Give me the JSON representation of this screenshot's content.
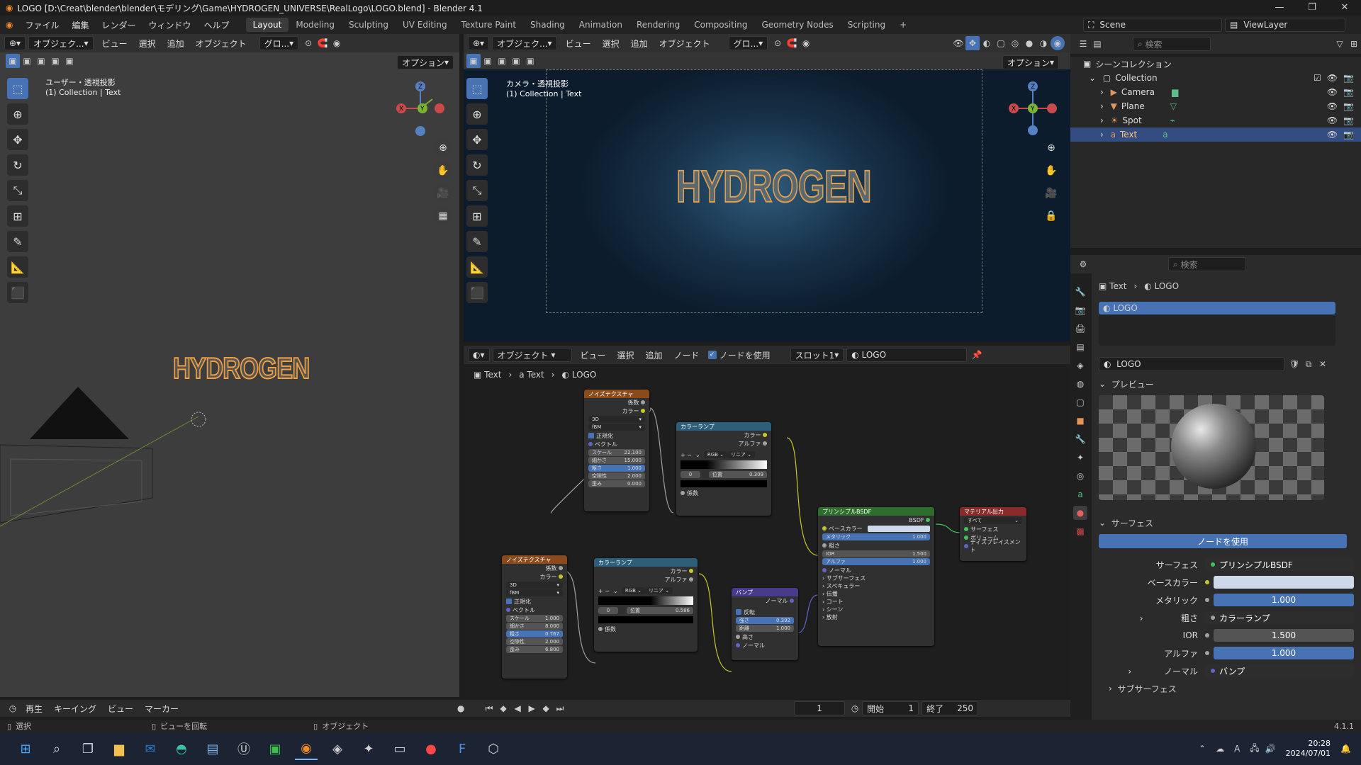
{
  "window": {
    "title": "LOGO [D:\\Creat\\blender\\blender\\モデリング\\Game\\HYDROGEN_UNIVERSE\\RealLogo\\LOGO.blend] - Blender 4.1"
  },
  "menu": [
    "ファイル",
    "編集",
    "レンダー",
    "ウィンドウ",
    "ヘルプ"
  ],
  "workspaces": [
    "Layout",
    "Modeling",
    "Sculpting",
    "UV Editing",
    "Texture Paint",
    "Shading",
    "Animation",
    "Rendering",
    "Compositing",
    "Geometry Nodes",
    "Scripting"
  ],
  "scene": {
    "scene_label": "Scene",
    "viewlayer_label": "ViewLayer"
  },
  "viewport_left": {
    "mode": "オブジェク...",
    "menus": [
      "ビュー",
      "選択",
      "追加",
      "オブジェクト"
    ],
    "orient": "グロ...",
    "options": "オプション",
    "info1": "ユーザー・透視投影",
    "info2": "(1) Collection | Text",
    "logo_text": "HYDROGEN"
  },
  "viewport_right": {
    "mode": "オブジェク...",
    "menus": [
      "ビュー",
      "選択",
      "追加",
      "オブジェクト"
    ],
    "orient": "グロ...",
    "options": "オプション",
    "info1": "カメラ・透視投影",
    "info2": "(1) Collection | Text",
    "logo_text": "HYDROGEN"
  },
  "node_editor": {
    "mode": "オブジェクト",
    "menus": [
      "ビュー",
      "選択",
      "追加",
      "ノード"
    ],
    "use_nodes": "ノードを使用",
    "slot": "スロット1",
    "material": "LOGO",
    "breadcrumb": [
      "Text",
      "Text",
      "LOGO"
    ]
  },
  "nodes": {
    "noise1": {
      "title": "ノイズテクスチャ",
      "out1": "係数",
      "out2": "カラー",
      "dim": "3D",
      "type": "fBM",
      "normalize": "正規化",
      "vector": "ベクトル",
      "rows": [
        [
          "スケール",
          "22.100"
        ],
        [
          "細かさ",
          "15.000"
        ],
        [
          "粗さ",
          "1.000"
        ],
        [
          "空隙性",
          "2.000"
        ],
        [
          "歪み",
          "0.000"
        ]
      ]
    },
    "ramp1": {
      "title": "カラーランプ",
      "out1": "カラー",
      "out2": "アルファ",
      "mode": "RGB",
      "interp": "リニア",
      "idx": "0",
      "pos_label": "位置",
      "pos": "0.309",
      "in": "係数"
    },
    "noise2": {
      "title": "ノイズテクスチャ",
      "out1": "係数",
      "out2": "カラー",
      "dim": "3D",
      "type": "fBM",
      "normalize": "正規化",
      "vector": "ベクトル",
      "rows": [
        [
          "スケール",
          "1.000"
        ],
        [
          "細かさ",
          "8.000"
        ],
        [
          "粗さ",
          "0.767"
        ],
        [
          "空隙性",
          "2.000"
        ],
        [
          "歪み",
          "6.800"
        ]
      ]
    },
    "ramp2": {
      "title": "カラーランプ",
      "out1": "カラー",
      "out2": "アルファ",
      "mode": "RGB",
      "interp": "リニア",
      "idx": "0",
      "pos_label": "位置",
      "pos": "0.586",
      "in": "係数"
    },
    "bump": {
      "title": "バンプ",
      "out": "ノーマル",
      "invert": "反転",
      "rows": [
        [
          "強さ",
          "0.392"
        ],
        [
          "距離",
          "1.000"
        ]
      ],
      "in1": "高さ",
      "in2": "ノーマル"
    },
    "bsdf": {
      "title": "プリンシプルBSDF",
      "out": "BSDF",
      "base": "ベースカラー",
      "metal": "メタリック",
      "metal_v": "1.000",
      "rough": "粗さ",
      "ior": "IOR",
      "ior_v": "1.500",
      "alpha": "アルファ",
      "alpha_v": "1.000",
      "normal": "ノーマル",
      "subs": [
        "サブサーフェス",
        "スペキュラー",
        "伝播",
        "コート",
        "シーン",
        "放射"
      ]
    },
    "output": {
      "title": "マテリアル出力",
      "target": "すべて",
      "ins": [
        "サーフェス",
        "ボリューム",
        "ディスプレイスメント"
      ]
    }
  },
  "outliner": {
    "root": "シーンコレクション",
    "collection": "Collection",
    "items": [
      "Camera",
      "Plane",
      "Spot",
      "Text"
    ]
  },
  "properties": {
    "search": "検索",
    "breadcrumb": [
      "Text",
      "LOGO"
    ],
    "slot": "LOGO",
    "material": "LOGO",
    "preview": "プレビュー",
    "surface": "サーフェス",
    "use_nodes": "ノードを使用",
    "rows": [
      [
        "サーフェス",
        "プリンシプルBSDF"
      ],
      [
        "ベースカラー",
        ""
      ],
      [
        "メタリック",
        "1.000"
      ],
      [
        "粗さ",
        "カラーランプ"
      ],
      [
        "IOR",
        "1.500"
      ],
      [
        "アルファ",
        "1.000"
      ],
      [
        "ノーマル",
        "バンプ"
      ]
    ],
    "subsurface": "サブサーフェス"
  },
  "timeline": {
    "menus": [
      "再生",
      "キーイング",
      "ビュー",
      "マーカー"
    ],
    "frame": "1",
    "start_label": "開始",
    "start": "1",
    "end_label": "終了",
    "end": "250"
  },
  "statusbar": {
    "select": "選択",
    "rotate": "ビューを回転",
    "object": "オブジェクト",
    "version": "4.1.1"
  },
  "taskbar": {
    "time": "20:28",
    "date": "2024/07/01"
  },
  "outliner_search": "検索",
  "colors": {
    "accent": "#4772b3",
    "noise_header": "#8a4a1c",
    "ramp_header": "#2e5f7a",
    "bump_header": "#4a3a8a",
    "bsdf_header": "#2f6d2f",
    "output_header": "#8a2b2b"
  }
}
